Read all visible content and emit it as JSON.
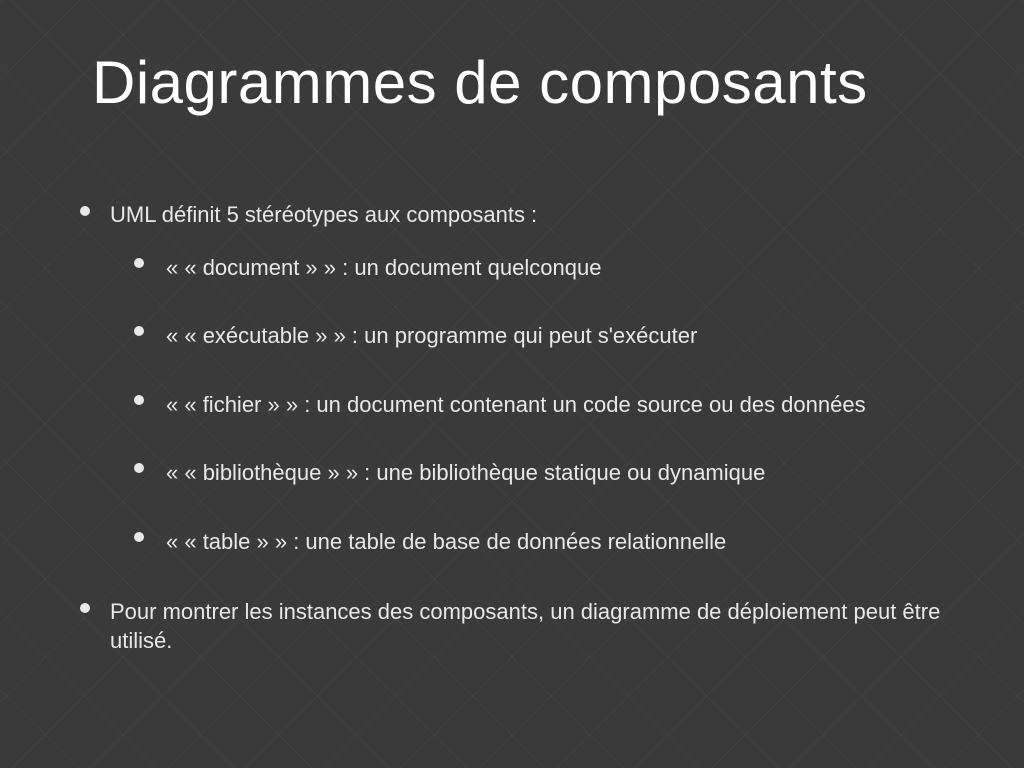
{
  "slide": {
    "title": "Diagrammes de composants",
    "bullets": [
      {
        "text": "UML définit 5 stéréotypes aux composants :",
        "sub": [
          "« « document » » : un document quelconque",
          "« « exécutable » » : un programme qui peut s'exécuter",
          "« « fichier » » : un document contenant un code source ou des données",
          "« « bibliothèque » » : une bibliothèque statique ou dynamique",
          "« « table » » : une table de base de données relationnelle"
        ]
      },
      {
        "text": "Pour montrer les instances des composants, un diagramme de déploiement peut être utilisé."
      }
    ]
  }
}
